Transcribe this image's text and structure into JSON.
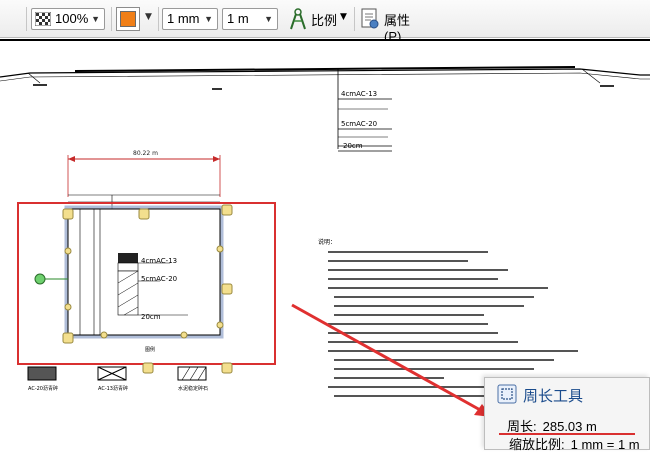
{
  "toolbar": {
    "opacity_value": "100%",
    "unit_small": "1 mm",
    "unit_large": "1 m",
    "scale_label": "比例",
    "properties_label": "属性(P)..."
  },
  "drawing": {
    "dimension_label": "80.22 m",
    "layer_labels": [
      "4cmAC-13",
      "5cmAC-20",
      "20cm"
    ],
    "small_layer_labels": [
      "4cmAC-13",
      "5cmAC-20",
      "20cm"
    ],
    "notes_heading": "说明：",
    "legend_captions": [
      "AC-20沥青碎",
      "AC-13沥青碎",
      "水泥稳定碎石"
    ],
    "figure_caption": "图例"
  },
  "perimeter_panel": {
    "title": "周长工具",
    "perimeter_label": "周长:",
    "perimeter_value": "285.03 m",
    "scale_label": "缩放比例:",
    "scale_value": "1 mm = 1 m"
  },
  "colors": {
    "selection_red": "#d93030",
    "handle_fill": "#f3df8e",
    "panel_title": "#1a4b8c"
  }
}
